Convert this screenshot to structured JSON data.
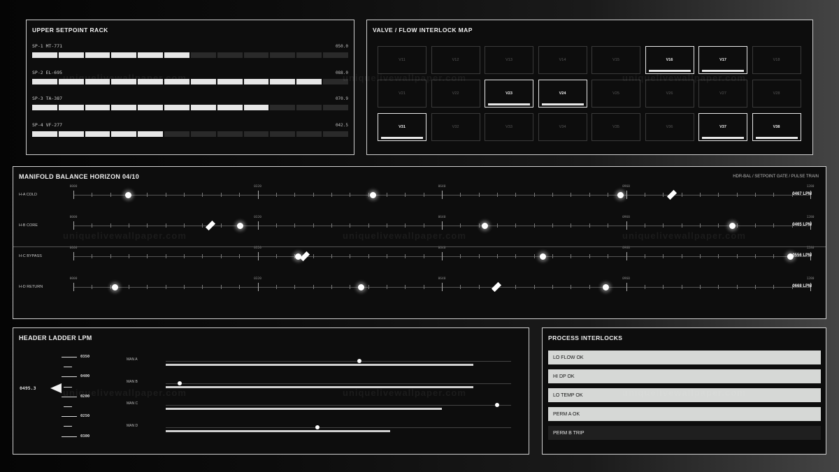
{
  "setpoint_rack": {
    "title": "UPPER SETPOINT RACK",
    "rows": [
      {
        "label": "SP-1 MT-771",
        "value": "050.0",
        "filled": 6
      },
      {
        "label": "SP-2 EL-695",
        "value": "088.0",
        "filled": 11
      },
      {
        "label": "SP-3 TA-387",
        "value": "070.9",
        "filled": 9
      },
      {
        "label": "SP-4 VF-277",
        "value": "042.5",
        "filled": 5
      }
    ],
    "segments": 12
  },
  "valve_map": {
    "title": "VALVE / FLOW INTERLOCK MAP",
    "rows": [
      [
        {
          "id": "V11",
          "on": false
        },
        {
          "id": "V12",
          "on": false
        },
        {
          "id": "V13",
          "on": false
        },
        {
          "id": "V14",
          "on": false
        },
        {
          "id": "V15",
          "on": false
        },
        {
          "id": "V16",
          "on": true
        },
        {
          "id": "V17",
          "on": true
        },
        {
          "id": "V18",
          "on": false
        }
      ],
      [
        {
          "id": "V21",
          "on": false
        },
        {
          "id": "V22",
          "on": false
        },
        {
          "id": "V23",
          "on": true
        },
        {
          "id": "V24",
          "on": true
        },
        {
          "id": "V25",
          "on": false
        },
        {
          "id": "V26",
          "on": false
        },
        {
          "id": "V27",
          "on": false
        },
        {
          "id": "V28",
          "on": false
        }
      ],
      [
        {
          "id": "V31",
          "on": true
        },
        {
          "id": "V32",
          "on": false
        },
        {
          "id": "V33",
          "on": false
        },
        {
          "id": "V34",
          "on": false
        },
        {
          "id": "V35",
          "on": false
        },
        {
          "id": "V36",
          "on": false
        },
        {
          "id": "V37",
          "on": true
        },
        {
          "id": "V38",
          "on": true
        }
      ]
    ]
  },
  "manifold": {
    "title": "MANIFOLD BALANCE HORIZON  04/10",
    "subtitle": "HDR-BAL / SETPOINT GATE / PULSE TRAIN",
    "scale_labels": [
      "0000",
      "0320",
      "0640",
      "0960",
      "1280"
    ],
    "scale_max": 1280,
    "rows": [
      {
        "label": "H-A COLD",
        "reading": "0467 LPM",
        "dots": [
          95,
          520,
          950
        ],
        "diamond": 1040
      },
      {
        "label": "H-B CORE",
        "reading": "0465 LPM",
        "dots": [
          290,
          715,
          1145
        ],
        "diamond": 238
      },
      {
        "label": "H-C BYPASS",
        "reading": "0556 LPM",
        "dots": [
          390,
          815,
          1245
        ],
        "diamond": 402
      },
      {
        "label": "H-D RETURN",
        "reading": "0668 LPM",
        "dots": [
          72,
          500,
          925
        ],
        "diamond": 735
      }
    ]
  },
  "header_ladder": {
    "title": "HEADER LADDER  LPM",
    "pointer_value": "0495.3",
    "ladder_labels": [
      "0350",
      "0400",
      "0200",
      "0250",
      "0300"
    ],
    "manifolds": [
      {
        "label": "MAN A",
        "bar": 0.89,
        "marker": 0.56
      },
      {
        "label": "MAN B",
        "bar": 0.89,
        "marker": 0.04
      },
      {
        "label": "MAN C",
        "bar": 0.8,
        "marker": 0.96
      },
      {
        "label": "MAN D",
        "bar": 0.65,
        "marker": 0.44
      }
    ]
  },
  "interlocks": {
    "title": "PROCESS INTERLOCKS",
    "items": [
      {
        "label": "LO FLOW  OK",
        "state": "ok"
      },
      {
        "label": "HI DP  OK",
        "state": "ok"
      },
      {
        "label": "LO TEMP  OK",
        "state": "ok"
      },
      {
        "label": "PERM A  OK",
        "state": "ok"
      },
      {
        "label": "PERM B  TRIP",
        "state": "trip"
      }
    ]
  },
  "watermark": "uniquelivewallpaper.com",
  "colors": {
    "panel_bg": "#0d0d0d",
    "accent": "#e6e6e6",
    "border": "#cfcfcf"
  }
}
